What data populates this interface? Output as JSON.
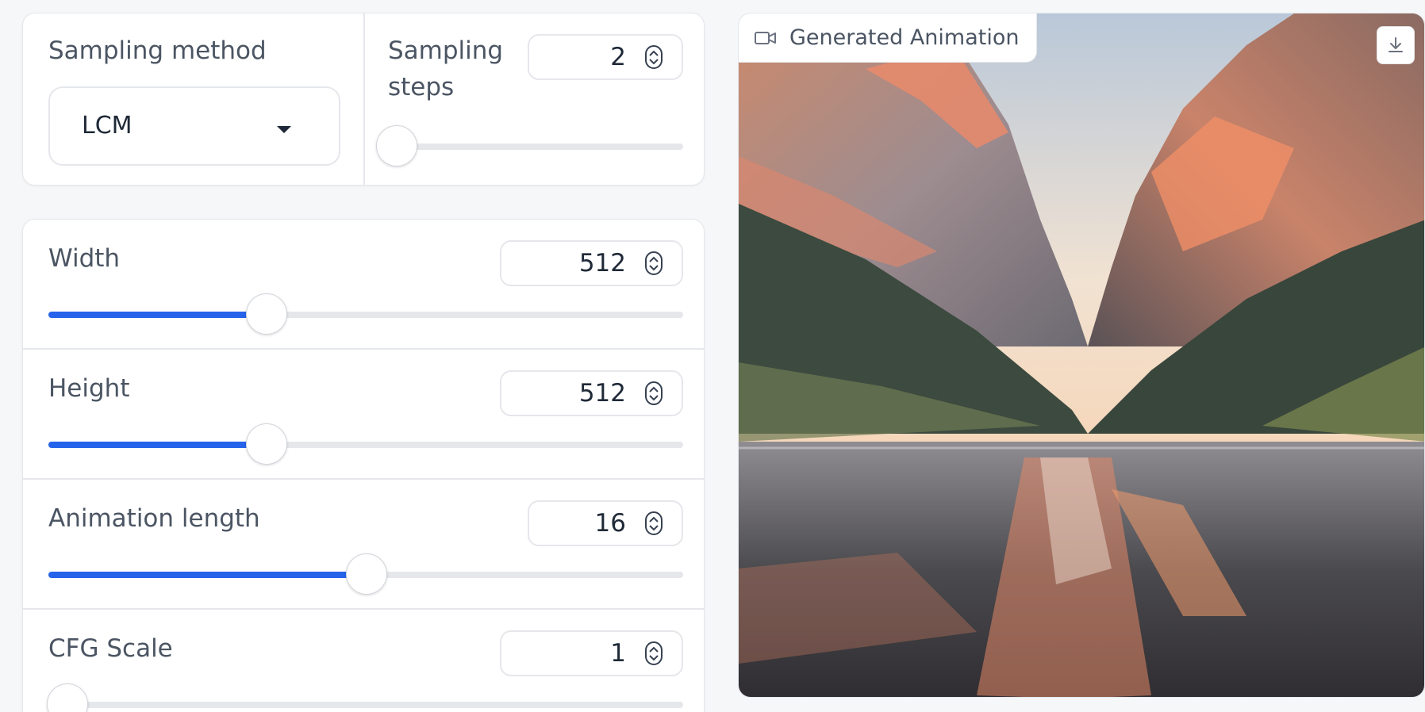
{
  "sampling": {
    "method_label": "Sampling method",
    "method_value": "LCM",
    "steps_label": "Sampling steps",
    "steps_value": "2",
    "steps_fraction": 0.03
  },
  "sliders": [
    {
      "label": "Width",
      "value": "512",
      "fraction": 0.344
    },
    {
      "label": "Height",
      "value": "512",
      "fraction": 0.344
    },
    {
      "label": "Animation length",
      "value": "16",
      "fraction": 0.501
    },
    {
      "label": "CFG Scale",
      "value": "1",
      "fraction": 0.03
    }
  ],
  "output": {
    "label": "Generated Animation",
    "label_icon": "video-camera-icon",
    "download_icon": "download-icon"
  },
  "colors": {
    "accent": "#2563eb",
    "track": "#e5e7eb",
    "panel_bg": "#ffffff",
    "page_bg": "#f6f7f9"
  }
}
